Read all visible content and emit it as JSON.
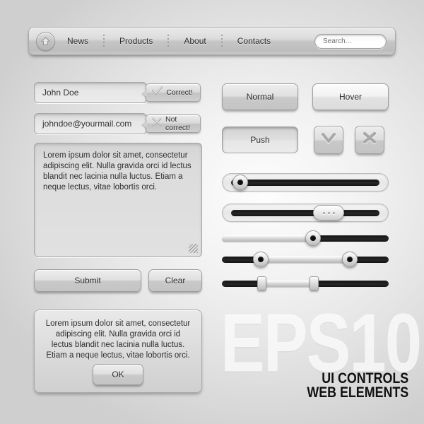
{
  "nav": {
    "home_icon": "home-icon",
    "items": [
      {
        "label": "News"
      },
      {
        "label": "Products"
      },
      {
        "label": "About"
      },
      {
        "label": "Contacts"
      }
    ],
    "search": {
      "placeholder": "Search...",
      "value": "Search..."
    }
  },
  "form": {
    "name_field": {
      "value": "John Doe"
    },
    "email_field": {
      "value": "johndoe@yourmail.com"
    },
    "validation": {
      "correct_label": "Correct!",
      "correct_icon": "check-icon",
      "wrong_label": "Not correct!",
      "wrong_icon": "cross-icon"
    },
    "textarea": {
      "value": "Lorem ipsum dolor sit amet, consectetur adipiscing elit. Nulla gravida orci id lectus blandit nec lacinia nulla luctus. Etiam a neque lectus, vitae lobortis orci."
    },
    "submit_label": "Submit",
    "clear_label": "Clear"
  },
  "buttons": {
    "normal_label": "Normal",
    "hover_label": "Hover",
    "push_label": "Push",
    "check_icon": "check-icon",
    "close_icon": "close-icon"
  },
  "sliders": [
    {
      "name": "slider-single-left",
      "style": "shell-dark-track",
      "value": 8,
      "fill": "none"
    },
    {
      "name": "slider-pill-handle",
      "style": "shell-dark-track",
      "value": 63,
      "fill": "none"
    },
    {
      "name": "slider-progress",
      "style": "bare",
      "value": 53,
      "fill": "left-light"
    },
    {
      "name": "slider-range-round",
      "style": "bare",
      "low": 20,
      "high": 74,
      "fill": "between-light"
    },
    {
      "name": "slider-range-rect",
      "style": "bare",
      "low": 22,
      "high": 53,
      "fill": "between-light"
    }
  ],
  "panel": {
    "message": "Lorem ipsum dolor sit amet, consectetur adipiscing elit. Nulla gravida orci id lectus blandit nec lacinia nulla luctus. Etiam a neque lectus, vitae lobortis orci.",
    "ok_label": "OK"
  },
  "watermark": {
    "eps": "EPS10",
    "line1": "UI CONTROLS",
    "line2": "WEB ELEMENTS"
  },
  "colors": {
    "background_light": "#fdfdfd",
    "background_edge": "#cfcfcf",
    "track_dark": "#141414",
    "text": "#2b2b2b"
  }
}
